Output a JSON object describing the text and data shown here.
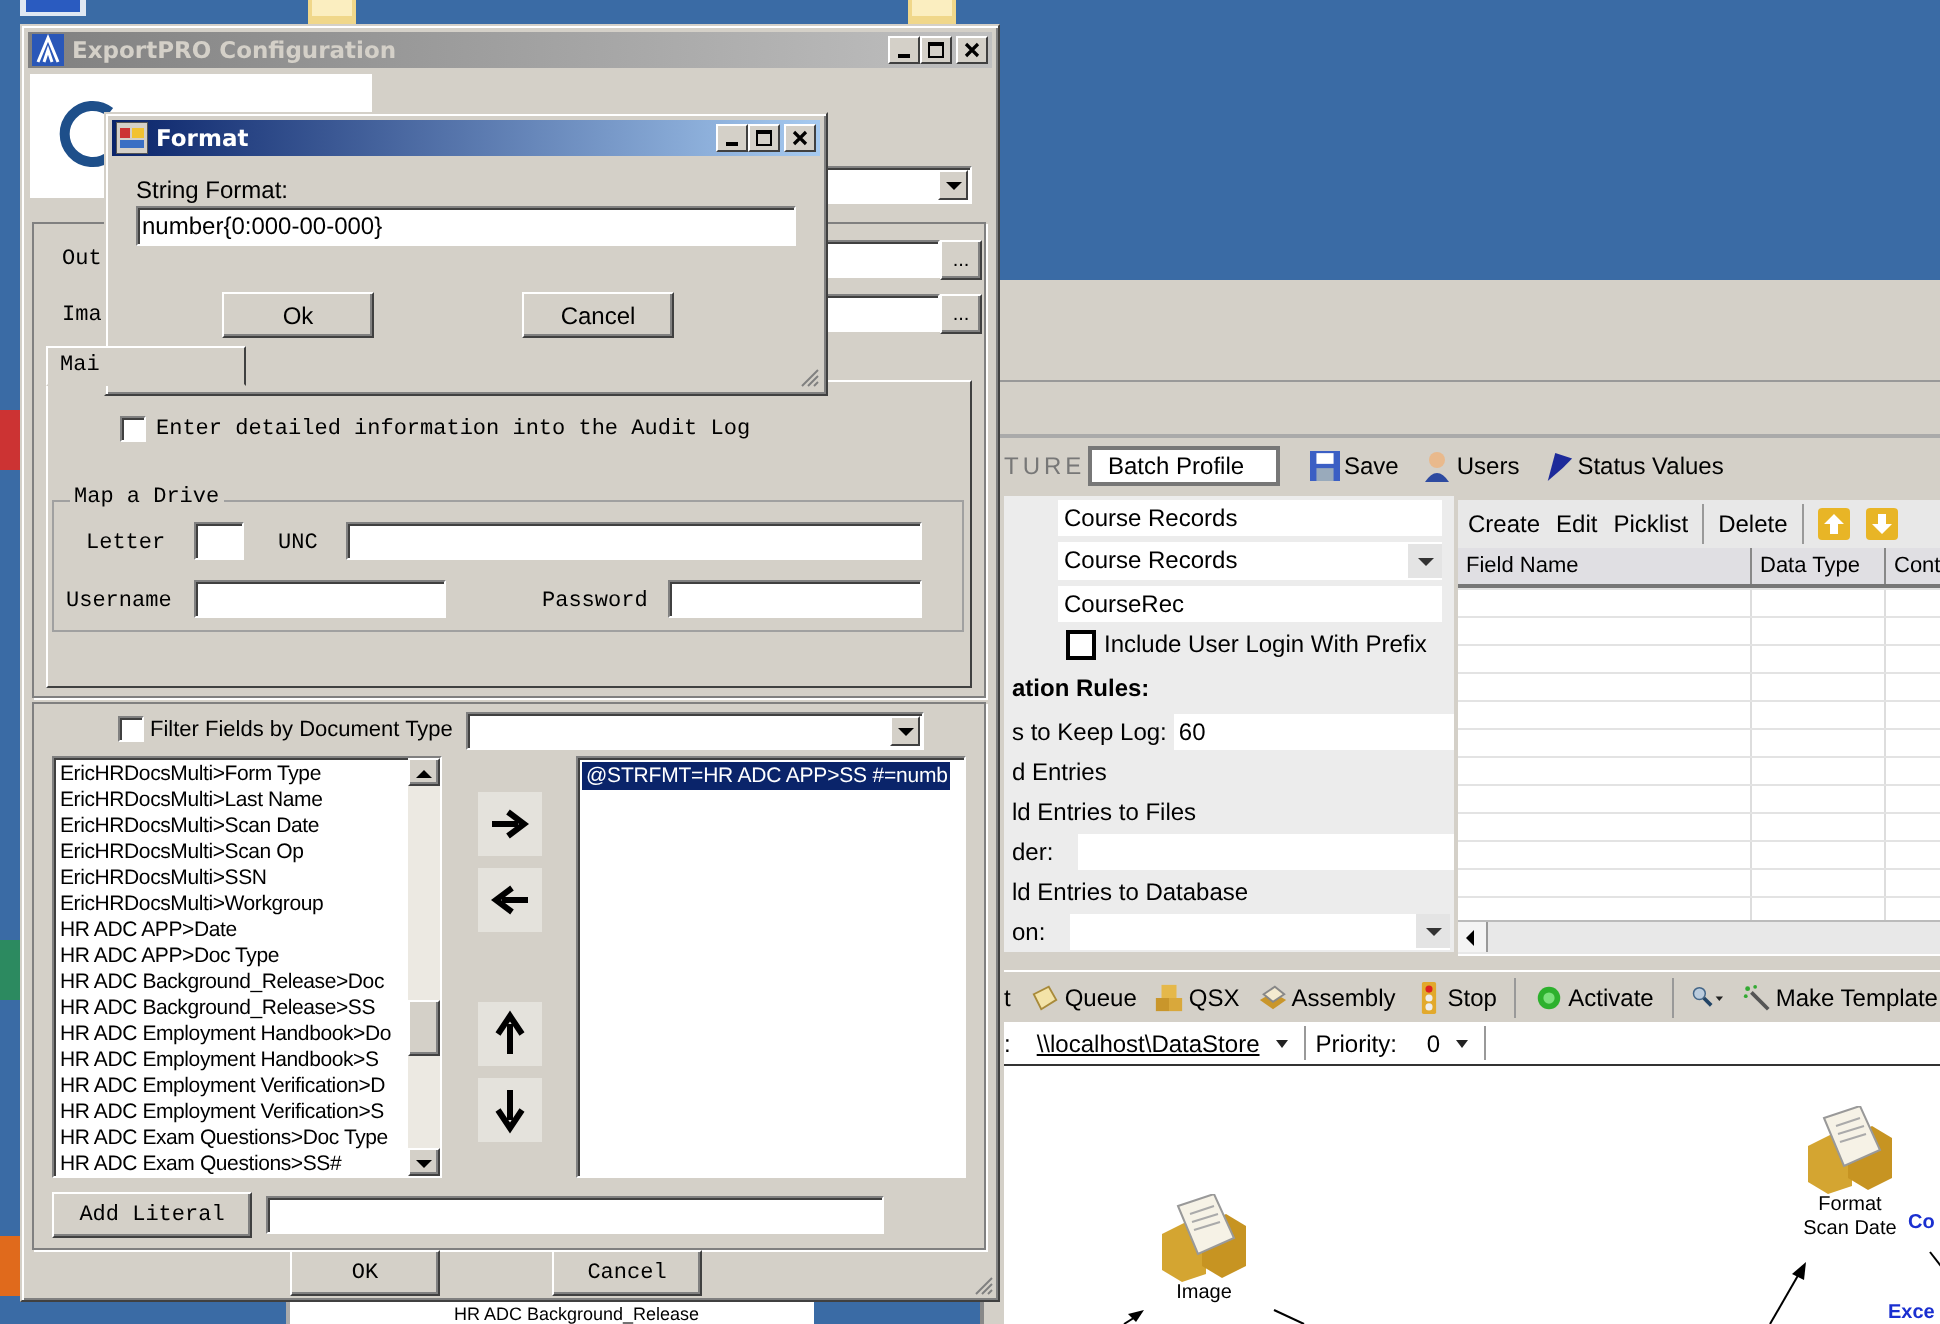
{
  "export_window": {
    "title": "ExportPRO Configuration",
    "output_label": "Out",
    "image_label": "Ima",
    "browse_buttons": [
      "...",
      "..."
    ],
    "tab": "Mai",
    "audit": {
      "label": "Enter detailed information into the Audit Log",
      "checked": false
    },
    "map_drive": {
      "title": "Map a Drive",
      "letter": "Letter",
      "unc": "UNC",
      "username": "Username",
      "password": "Password"
    },
    "filter": {
      "label": "Filter Fields by Document Type",
      "checked": false
    },
    "available_fields": [
      {
        "text": "EricHRDocsMulti>Form Type",
        "selected": false
      },
      {
        "text": "EricHRDocsMulti>Last Name",
        "selected": false
      },
      {
        "text": "EricHRDocsMulti>Scan Date",
        "selected": false
      },
      {
        "text": "EricHRDocsMulti>Scan Op",
        "selected": false
      },
      {
        "text": "EricHRDocsMulti>SSN",
        "selected": false
      },
      {
        "text": "EricHRDocsMulti>Workgroup",
        "selected": false
      },
      {
        "text": "HR ADC APP>Date",
        "selected": false
      },
      {
        "text": "HR ADC APP>Doc Type",
        "selected": false
      },
      {
        "text": "HR ADC Background_Release>Doc",
        "selected": false
      },
      {
        "text": "HR ADC Background_Release>SS",
        "selected": false
      },
      {
        "text": "HR ADC Employment Handbook>Do",
        "selected": false
      },
      {
        "text": "HR ADC Employment Handbook>S",
        "selected": false
      },
      {
        "text": "HR ADC Employment Verification>D",
        "selected": false
      },
      {
        "text": "HR ADC Employment Verification>S",
        "selected": false
      },
      {
        "text": "HR ADC Exam Questions>Doc Type",
        "selected": false
      },
      {
        "text": "HR ADC Exam Questions>SS#",
        "selected": false
      }
    ],
    "mapped_fields": [
      {
        "text": "@STRFMT=HR ADC APP>SS #=numb",
        "selected": true
      }
    ],
    "add_literal": "Add Literal",
    "ok": "OK",
    "cancel": "Cancel"
  },
  "format_dialog": {
    "title": "Format",
    "label": "String Format:",
    "value": "number{0:000-00-000}",
    "ok": "Ok",
    "cancel": "Cancel"
  },
  "workflow_window": {
    "logo_text": "TURE",
    "profile": "Batch Profile",
    "top_buttons": [
      "Save",
      "Users",
      "Status Values"
    ],
    "form": {
      "fields": [
        {
          "kind": "text",
          "value": "Course Records"
        },
        {
          "kind": "dropdown",
          "value": "Course Records"
        },
        {
          "kind": "text",
          "value": "CourseRec"
        }
      ],
      "include_login": {
        "label": "Include User Login With Prefix",
        "checked": false
      },
      "section_title": "ation Rules:",
      "keep_log_label": "s to Keep Log:",
      "keep_log_value": "60",
      "entries_label": "d Entries",
      "files_label": "ld Entries to Files",
      "folder_label": "der:",
      "database_label": "ld Entries to Database",
      "connection_label": "on:"
    },
    "grid_toolbar": [
      "Create",
      "Edit",
      "Picklist",
      "Delete"
    ],
    "grid_columns": [
      "Field Name",
      "Data Type",
      "Cont"
    ],
    "flow_toolbar": [
      "t",
      "Queue",
      "QSX",
      "Assembly",
      "Stop",
      "Activate",
      "Make Template"
    ],
    "location_label": ":",
    "location": "\\\\localhost\\DataStore",
    "priority_label": "Priority:",
    "priority": "0",
    "nodes": [
      {
        "label": "Image"
      },
      {
        "label": "Format Scan Date"
      }
    ],
    "link_labels": [
      "Co",
      "Exce"
    ]
  },
  "back_window": {
    "text": "HR ADC Background_Release"
  }
}
